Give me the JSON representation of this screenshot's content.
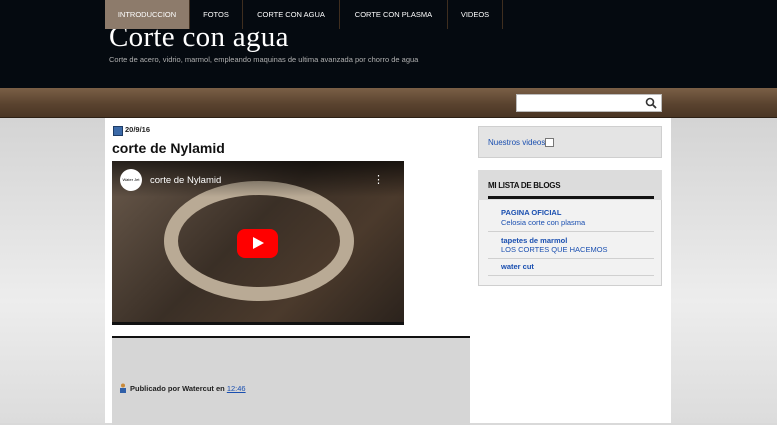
{
  "header": {
    "title": "Corte con agua",
    "description": "Corte de acero, vidrio, marmol, empleando maquinas de ultima avanzada por chorro de agua"
  },
  "nav": {
    "items": [
      {
        "label": "INTRODUCCION",
        "active": true
      },
      {
        "label": "FOTOS"
      },
      {
        "label": "CORTE CON AGUA"
      },
      {
        "label": "CORTE CON PLASMA"
      },
      {
        "label": "VIDEOS"
      }
    ],
    "search_placeholder": ""
  },
  "post": {
    "date": "20/9/16",
    "title": "corte de Nylamid",
    "video": {
      "title": "corte de Nylamid",
      "channel_avatar_text": "Water Jet"
    },
    "footer": {
      "posted_by": "Publicado por Watercut en",
      "time": "12:46"
    }
  },
  "sidebar": {
    "videos_link": "Nuestros videos",
    "blogs": {
      "title": "MI LISTA DE BLOGS",
      "items": [
        {
          "name": "PAGINA OFICIAL",
          "post": "Celosia corte con plasma"
        },
        {
          "name": "tapetes de marmol",
          "post": "LOS CORTES QUE HACEMOS"
        },
        {
          "name": "water cut",
          "post": ""
        }
      ]
    }
  },
  "colors": {
    "header_bg": "#050a10",
    "nav_bg": "#5a432f",
    "nav_active": "#8d7b6b",
    "link": "#1a4fb0",
    "play_button": "#ff0000"
  }
}
